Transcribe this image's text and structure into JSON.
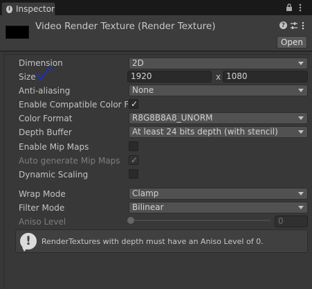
{
  "window": {
    "tab_label": "Inspector",
    "tab_icon": "info-icon"
  },
  "header": {
    "title": "Video Render Texture (Render Texture)",
    "open_label": "Open"
  },
  "properties": {
    "dimension": {
      "label": "Dimension",
      "value": "2D"
    },
    "size": {
      "label": "Size",
      "width": "1920",
      "separator": "x",
      "height": "1080"
    },
    "anti_aliasing": {
      "label": "Anti-aliasing",
      "value": "None"
    },
    "enable_compatible_color_format": {
      "label": "Enable Compatible Color For",
      "checked": true
    },
    "color_format": {
      "label": "Color Format",
      "value": "R8G8B8A8_UNORM"
    },
    "depth_buffer": {
      "label": "Depth Buffer",
      "value": "At least 24 bits depth (with stencil)"
    },
    "enable_mip_maps": {
      "label": "Enable Mip Maps",
      "checked": false
    },
    "auto_generate_mip_maps": {
      "label": "Auto generate Mip Maps",
      "checked": true,
      "disabled": true
    },
    "dynamic_scaling": {
      "label": "Dynamic Scaling",
      "checked": false
    },
    "wrap_mode": {
      "label": "Wrap Mode",
      "value": "Clamp"
    },
    "filter_mode": {
      "label": "Filter Mode",
      "value": "Bilinear"
    },
    "aniso_level": {
      "label": "Aniso Level",
      "value": "0",
      "disabled": true
    }
  },
  "helpbox": {
    "message": "RenderTextures with depth must have an Aniso Level of 0."
  },
  "colors": {
    "annotation_check": "#1b2dd6",
    "panel_bg": "#383838",
    "header_bg": "#3c3c3c"
  }
}
